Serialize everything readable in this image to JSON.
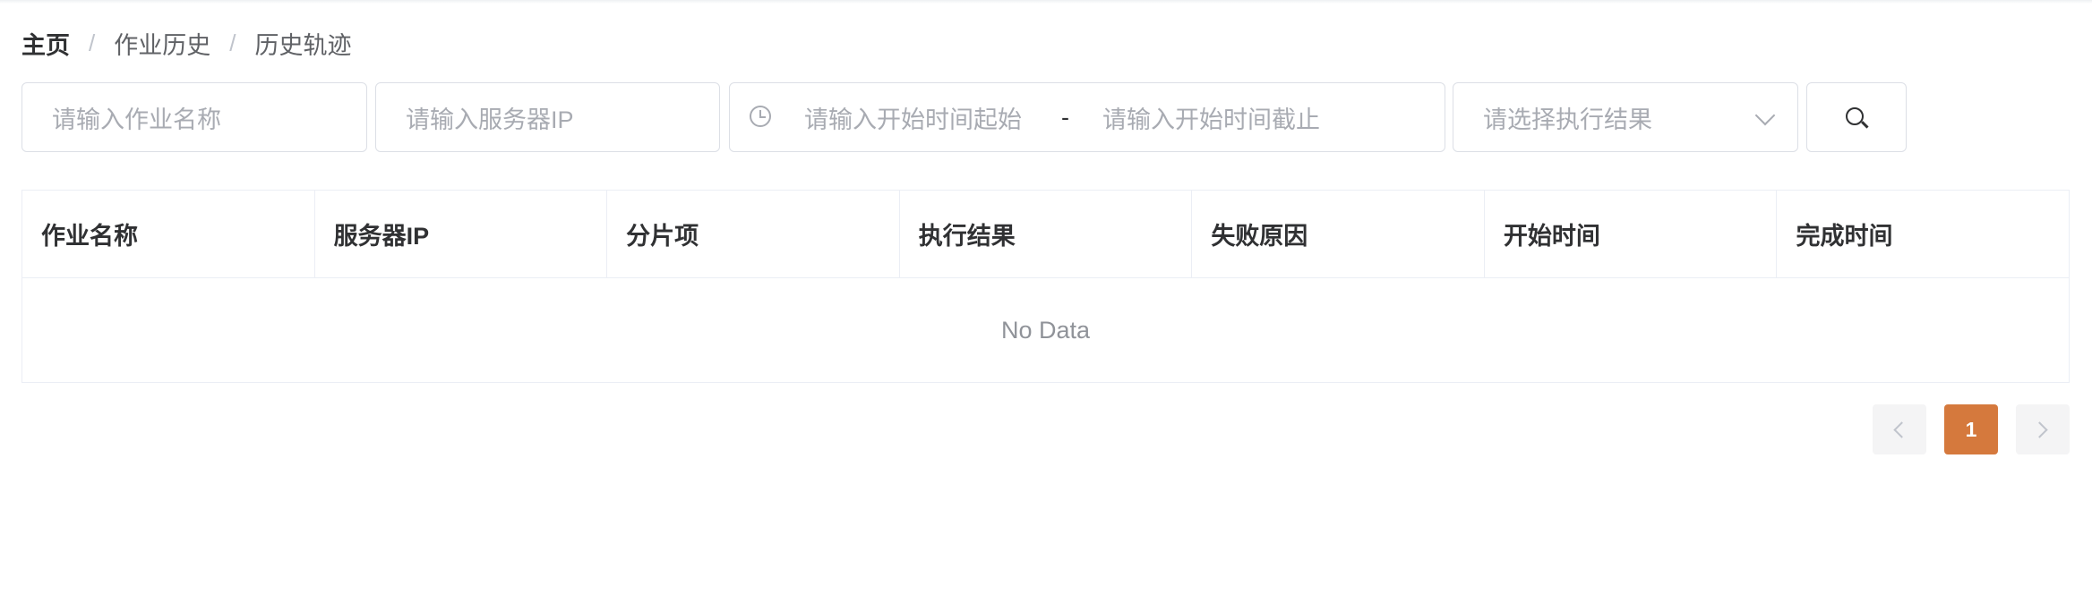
{
  "breadcrumb": {
    "items": [
      "主页",
      "作业历史",
      "历史轨迹"
    ],
    "separator": "/"
  },
  "filters": {
    "job_name_placeholder": "请输入作业名称",
    "server_ip_placeholder": "请输入服务器IP",
    "start_time_from_placeholder": "请输入开始时间起始",
    "range_separator": "-",
    "start_time_to_placeholder": "请输入开始时间截止",
    "result_select_placeholder": "请选择执行结果"
  },
  "table": {
    "columns": [
      "作业名称",
      "服务器IP",
      "分片项",
      "执行结果",
      "失败原因",
      "开始时间",
      "完成时间"
    ],
    "rows": [],
    "empty_text": "No Data"
  },
  "pagination": {
    "current_page": "1"
  },
  "colors": {
    "accent": "#d5793d",
    "border": "#dcdfe6",
    "placeholder": "#a8abb2"
  },
  "icons": {
    "time_range": "clock-icon",
    "select": "chevron-down-icon",
    "search": "search-icon",
    "prev": "chevron-left-icon",
    "next": "chevron-right-icon"
  }
}
